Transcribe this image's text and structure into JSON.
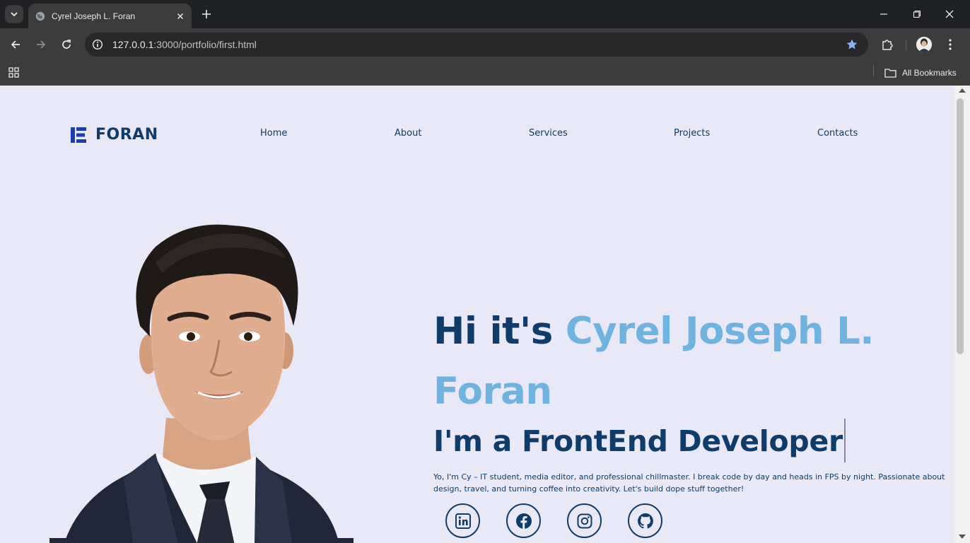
{
  "browser": {
    "tab_title": "Cyrel Joseph L. Foran",
    "url_host": "127.0.0.1",
    "url_rest": ":3000/portfolio/first.html",
    "all_bookmarks_label": "All Bookmarks"
  },
  "page": {
    "logo_text": "FORAN",
    "nav": [
      {
        "label": "Home"
      },
      {
        "label": "About"
      },
      {
        "label": "Services"
      },
      {
        "label": "Projects"
      },
      {
        "label": "Contacts"
      }
    ],
    "hero": {
      "greeting": "Hi it's ",
      "name": "Cyrel Joseph L. Foran",
      "role": "I'm a FrontEnd Developer",
      "description": "Yo, I'm Cy – IT student, media editor, and professional chillmaster. I break code by day and heads in FPS by night. Passionate about design, travel, and turning coffee into creativity. Let's build dope stuff together!"
    },
    "socials": [
      {
        "icon": "linkedin-icon"
      },
      {
        "icon": "facebook-icon"
      },
      {
        "icon": "instagram-icon"
      },
      {
        "icon": "github-icon"
      }
    ]
  },
  "colors": {
    "primary": "#0f3c6b",
    "accent": "#6fb3e0",
    "page_bg": "#e8e8f6",
    "logo_blue": "#1d3fae"
  }
}
